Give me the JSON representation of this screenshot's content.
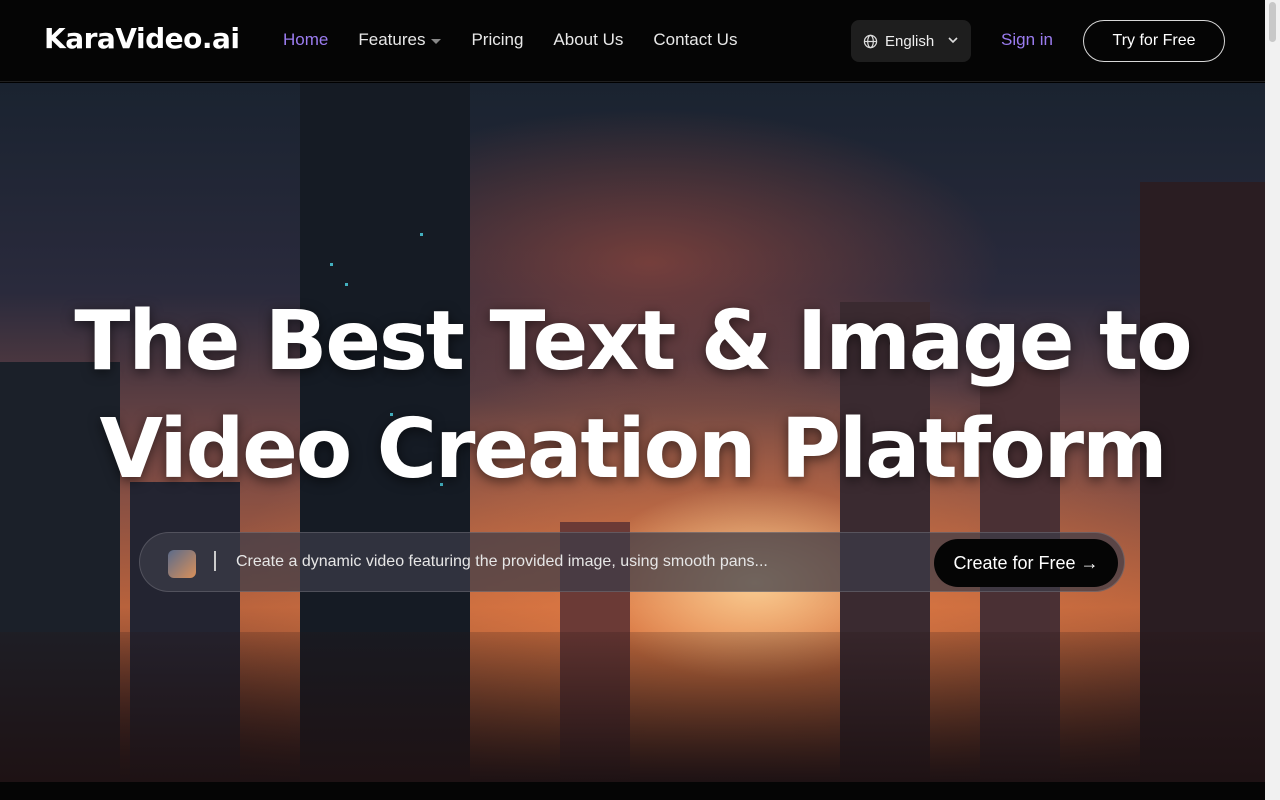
{
  "header": {
    "logo": "KaraVideo.ai",
    "nav": [
      {
        "label": "Home",
        "active": true
      },
      {
        "label": "Features",
        "dropdown": true
      },
      {
        "label": "Pricing"
      },
      {
        "label": "About Us"
      },
      {
        "label": "Contact Us"
      }
    ],
    "language": "English",
    "sign_in": "Sign in",
    "try_free": "Try for Free"
  },
  "hero": {
    "title_line1": "The Best Text & Image to",
    "title_line2": "Video Creation Platform",
    "prompt_text": "Create a dynamic video featuring the provided image, using smooth pans...",
    "create_button": "Create for Free →"
  },
  "colors": {
    "accent": "#9b7cf0",
    "header_bg": "#050505"
  }
}
